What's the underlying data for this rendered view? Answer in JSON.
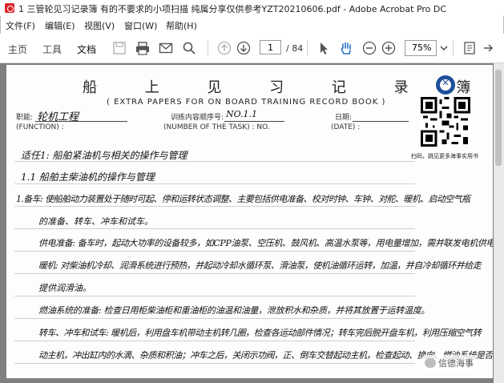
{
  "window": {
    "title": "1 三管轮见习记录簿 有的不要求的小项扫描 纯属分享仅供参考YZT20210606.pdf - Adobe Acrobat Pro DC"
  },
  "menubar": {
    "items": [
      "文件(F)",
      "编辑(E)",
      "视图(V)",
      "窗口(W)",
      "帮助(H)"
    ]
  },
  "toolbar": {
    "tabs": [
      "主页",
      "工具",
      "文档"
    ],
    "active_tab": "文档",
    "page_current": "1",
    "page_total": "/ 84",
    "zoom": "75%"
  },
  "document": {
    "title": "船 上 见 习 记 录 簿 附 页",
    "subtitle": "( EXTRA PAPERS FOR ON BOARD TRAINING RECORD BOOK )",
    "field_job_label": "职能:",
    "field_job_value": "轮机工程",
    "field_function_label": "(FUNCTION) :",
    "field_task_label": "训练内容顺序号:",
    "field_task_value": "NO.1.1",
    "field_task_en": "(NUMBER OF THE TASK) : NO.",
    "field_date_label": "日期:",
    "field_date_en": "(DATE) :",
    "qr_caption": "扫码，跳见更多海事实用书",
    "handwriting": [
      "适任1: 船舶紧油机与相关的操作与管理",
      "1.1 船舶主柴油机的操作与管理",
      "1.备车: 使船舶动力装置处于随时可起、停和运转状态调整、主要包括供电准备、校对时钟、车钟、对舵、暖机、启动空气瓶",
      "的准备、转车、冲车和试车。",
      "供电准备: 备车时，起动大功率的设备较多，如CPP油泵、空压机、鼓风机、高温水泵等，用电量增加，需并联发电机供电。",
      "暖机: 对柴油机冷却、润滑系统进行预热，并起动冷却水循环泵、滑油泵，使机油循环运转，加温，并自冷却循环并给走",
      "提供润滑油。",
      "燃油系统的准备: 检查日用柜柴油柜和重油柜的油温和油量，泄放积水和杂质，并将其放置于运转温度。",
      "转车、冲车和试车: 暖机后，利用盘车机带动主机转几圈，检查各运动部件情况；转车完后脱开盘车机，利用压缩空气转",
      "动主机，冲出缸内的水滴、杂质和积油；冲车之后，关闭示功阀，正、倒车交替起动主机，检查起动、换向、燃油系统是否"
    ]
  },
  "watermark": {
    "text": "信德海事"
  },
  "icons": [
    "app-icon",
    "save-icon",
    "print-icon",
    "mail-icon",
    "search-icon",
    "prev-page-icon",
    "next-page-icon",
    "select-arrow-icon",
    "hand-tool-icon",
    "zoom-out-icon",
    "zoom-in-icon",
    "dropdown-icon",
    "qr-code-icon",
    "school-logo-icon",
    "wechat-icon"
  ]
}
